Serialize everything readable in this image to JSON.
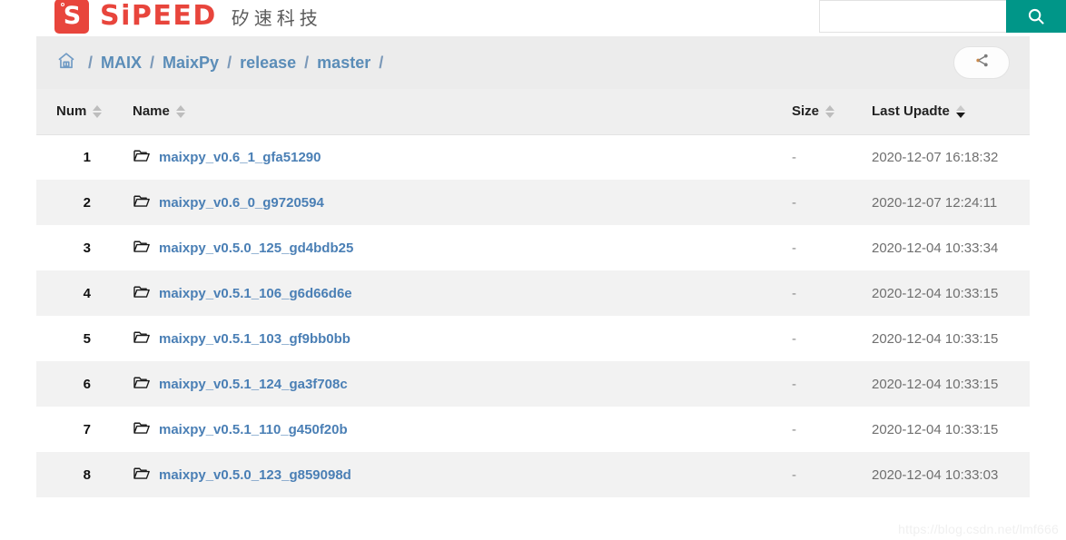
{
  "header": {
    "logo_letter": "S",
    "logo_text": "SiPEED",
    "logo_subtitle": "矽速科技",
    "brand_color": "#e8453c",
    "search": {
      "value": "",
      "placeholder": "",
      "button_icon": "search-icon",
      "button_color": "#009688"
    }
  },
  "breadcrumb": {
    "home_icon": "home-icon",
    "separator": "/",
    "items": [
      {
        "label": "MAIX"
      },
      {
        "label": "MaixPy"
      },
      {
        "label": "release"
      },
      {
        "label": "master"
      }
    ],
    "share_icon": "share-icon",
    "link_color": "#5b8db8"
  },
  "table": {
    "columns": [
      {
        "key": "num",
        "label": "Num",
        "sortable": true,
        "sort_state": "none"
      },
      {
        "key": "name",
        "label": "Name",
        "sortable": true,
        "sort_state": "none"
      },
      {
        "key": "size",
        "label": "Size",
        "sortable": true,
        "sort_state": "none"
      },
      {
        "key": "date",
        "label": "Last Upadte",
        "sortable": true,
        "sort_state": "desc"
      }
    ],
    "rows": [
      {
        "num": "1",
        "icon": "folder-icon",
        "name": "maixpy_v0.6_1_gfa51290",
        "size": "-",
        "date": "2020-12-07 16:18:32"
      },
      {
        "num": "2",
        "icon": "folder-icon",
        "name": "maixpy_v0.6_0_g9720594",
        "size": "-",
        "date": "2020-12-07 12:24:11"
      },
      {
        "num": "3",
        "icon": "folder-icon",
        "name": "maixpy_v0.5.0_125_gd4bdb25",
        "size": "-",
        "date": "2020-12-04 10:33:34"
      },
      {
        "num": "4",
        "icon": "folder-icon",
        "name": "maixpy_v0.5.1_106_g6d66d6e",
        "size": "-",
        "date": "2020-12-04 10:33:15"
      },
      {
        "num": "5",
        "icon": "folder-icon",
        "name": "maixpy_v0.5.1_103_gf9bb0bb",
        "size": "-",
        "date": "2020-12-04 10:33:15"
      },
      {
        "num": "6",
        "icon": "folder-icon",
        "name": "maixpy_v0.5.1_124_ga3f708c",
        "size": "-",
        "date": "2020-12-04 10:33:15"
      },
      {
        "num": "7",
        "icon": "folder-icon",
        "name": "maixpy_v0.5.1_110_g450f20b",
        "size": "-",
        "date": "2020-12-04 10:33:15"
      },
      {
        "num": "8",
        "icon": "folder-icon",
        "name": "maixpy_v0.5.0_123_g859098d",
        "size": "-",
        "date": "2020-12-04 10:33:03"
      }
    ],
    "link_color": "#4a7fb5"
  },
  "watermark": {
    "text": "https://blog.csdn.net/lmf666"
  }
}
